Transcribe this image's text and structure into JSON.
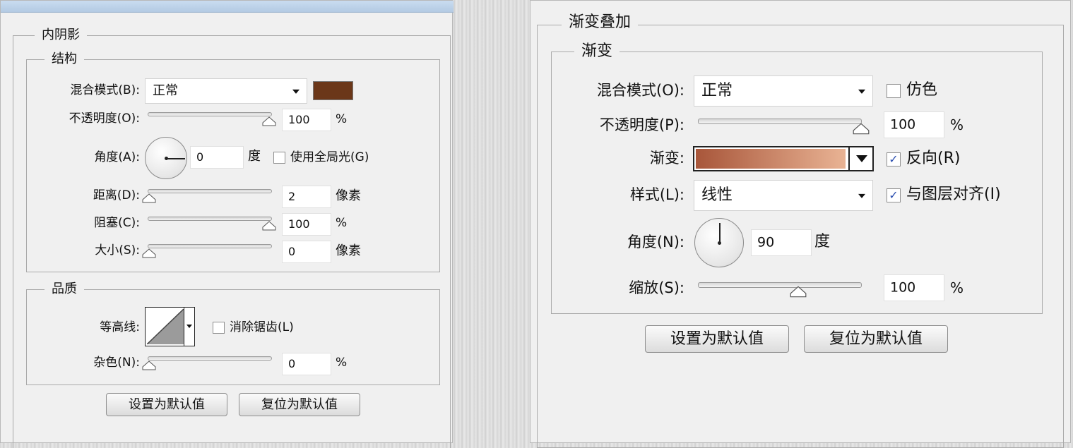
{
  "left": {
    "group_title": "内阴影",
    "structure": {
      "title": "结构",
      "blend_mode_label": "混合模式(B):",
      "blend_mode_value": "正常",
      "color": "#6b3719",
      "opacity_label": "不透明度(O):",
      "opacity_value": "100",
      "opacity_unit": "%",
      "angle_label": "角度(A):",
      "angle_value": "0",
      "angle_unit": "度",
      "global_light_label": "使用全局光(G)",
      "global_light_checked": false,
      "distance_label": "距离(D):",
      "distance_value": "2",
      "distance_unit": "像素",
      "choke_label": "阻塞(C):",
      "choke_value": "100",
      "choke_unit": "%",
      "size_label": "大小(S):",
      "size_value": "0",
      "size_unit": "像素"
    },
    "quality": {
      "title": "品质",
      "contour_label": "等高线:",
      "antialias_label": "消除锯齿(L)",
      "antialias_checked": false,
      "noise_label": "杂色(N):",
      "noise_value": "0",
      "noise_unit": "%"
    },
    "buttons": {
      "default_label": "设置为默认值",
      "reset_label": "复位为默认值"
    }
  },
  "right": {
    "group_title": "渐变叠加",
    "gradient_group": {
      "title": "渐变",
      "blend_mode_label": "混合模式(O):",
      "blend_mode_value": "正常",
      "dither_label": "仿色",
      "dither_checked": false,
      "opacity_label": "不透明度(P):",
      "opacity_value": "100",
      "opacity_unit": "%",
      "gradient_label": "渐变:",
      "gradient_start_color": "#a8563a",
      "gradient_end_color": "#e9b394",
      "reverse_label": "反向(R)",
      "reverse_checked": true,
      "style_label": "样式(L):",
      "style_value": "线性",
      "align_label": "与图层对齐(I)",
      "align_checked": true,
      "angle_label": "角度(N):",
      "angle_value": "90",
      "angle_unit": "度",
      "scale_label": "缩放(S):",
      "scale_value": "100",
      "scale_unit": "%"
    },
    "buttons": {
      "default_label": "设置为默认值",
      "reset_label": "复位为默认值"
    }
  },
  "icons": {
    "check_mark": "✓"
  }
}
